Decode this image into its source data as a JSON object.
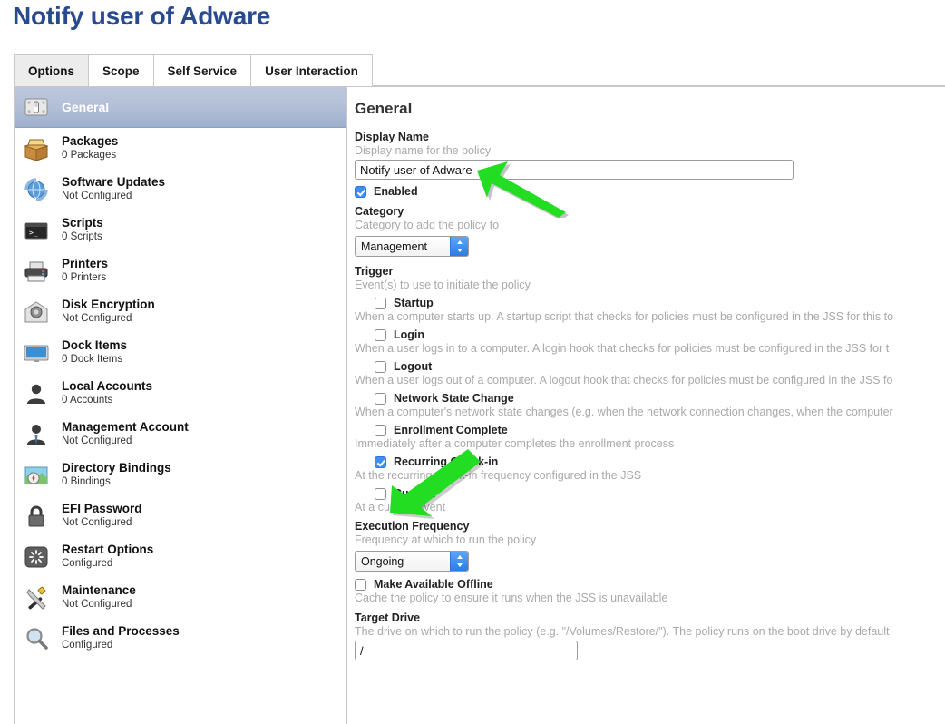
{
  "page": {
    "title": "Notify user of Adware"
  },
  "tabs": [
    {
      "label": "Options",
      "active": true
    },
    {
      "label": "Scope",
      "active": false
    },
    {
      "label": "Self Service",
      "active": false
    },
    {
      "label": "User Interaction",
      "active": false
    }
  ],
  "sidebar": {
    "items": [
      {
        "label": "General",
        "sub": "",
        "icon": "switch-icon",
        "selected": true
      },
      {
        "label": "Packages",
        "sub": "0 Packages",
        "icon": "package-box-icon",
        "selected": false
      },
      {
        "label": "Software Updates",
        "sub": "Not Configured",
        "icon": "software-update-icon",
        "selected": false
      },
      {
        "label": "Scripts",
        "sub": "0 Scripts",
        "icon": "terminal-icon",
        "selected": false
      },
      {
        "label": "Printers",
        "sub": "0 Printers",
        "icon": "printer-icon",
        "selected": false
      },
      {
        "label": "Disk Encryption",
        "sub": "Not Configured",
        "icon": "filevault-house-icon",
        "selected": false
      },
      {
        "label": "Dock Items",
        "sub": "0 Dock Items",
        "icon": "display-icon",
        "selected": false
      },
      {
        "label": "Local Accounts",
        "sub": "0 Accounts",
        "icon": "user-icon",
        "selected": false
      },
      {
        "label": "Management Account",
        "sub": "Not Configured",
        "icon": "user-tie-icon",
        "selected": false
      },
      {
        "label": "Directory Bindings",
        "sub": "0 Bindings",
        "icon": "map-compass-icon",
        "selected": false
      },
      {
        "label": "EFI Password",
        "sub": "Not Configured",
        "icon": "lock-icon",
        "selected": false
      },
      {
        "label": "Restart Options",
        "sub": "Configured",
        "icon": "restart-spinner-icon",
        "selected": false
      },
      {
        "label": "Maintenance",
        "sub": "Not Configured",
        "icon": "tools-icon",
        "selected": false
      },
      {
        "label": "Files and Processes",
        "sub": "Configured",
        "icon": "magnifier-icon",
        "selected": false
      }
    ]
  },
  "main": {
    "heading": "General",
    "display_name": {
      "label": "Display Name",
      "hint": "Display name for the policy",
      "value": "Notify user of Adware"
    },
    "enabled": {
      "label": "Enabled",
      "checked": true
    },
    "category": {
      "label": "Category",
      "hint": "Category to add the policy to",
      "value": "Management"
    },
    "trigger": {
      "label": "Trigger",
      "hint": "Event(s) to use to initiate the policy",
      "options": [
        {
          "label": "Startup",
          "checked": false,
          "desc": "When a computer starts up. A startup script that checks for policies must be configured in the JSS for this to"
        },
        {
          "label": "Login",
          "checked": false,
          "desc": "When a user logs in to a computer. A login hook that checks for policies must be configured in the JSS for t"
        },
        {
          "label": "Logout",
          "checked": false,
          "desc": "When a user logs out of a computer. A logout hook that checks for policies must be configured in the JSS fo"
        },
        {
          "label": "Network State Change",
          "checked": false,
          "desc": "When a computer's network state changes (e.g. when the network connection changes, when the computer"
        },
        {
          "label": "Enrollment Complete",
          "checked": false,
          "desc": "Immediately after a computer completes the enrollment process"
        },
        {
          "label": "Recurring Check-in",
          "checked": true,
          "desc": "At the recurring check-in frequency configured in the JSS"
        },
        {
          "label": "Custom",
          "checked": false,
          "desc": "At a custom event"
        }
      ]
    },
    "execution_frequency": {
      "label": "Execution Frequency",
      "hint": "Frequency at which to run the policy",
      "value": "Ongoing"
    },
    "make_available_offline": {
      "label": "Make Available Offline",
      "checked": false,
      "desc": "Cache the policy to ensure it runs when the JSS is unavailable"
    },
    "target_drive": {
      "label": "Target Drive",
      "hint": "The drive on which to run the policy (e.g. \"/Volumes/Restore/\"). The policy runs on the boot drive by default",
      "value": "/"
    }
  },
  "annotations": {
    "arrow_color": "#22dd22",
    "arrows": [
      {
        "name": "arrow-to-display-name-field"
      },
      {
        "name": "arrow-to-recurring-checkin-checkbox"
      }
    ]
  },
  "colors": {
    "title": "#2a4a90",
    "accent_blue": "#3e8ef7",
    "selected_row": "#a8b6d0"
  }
}
